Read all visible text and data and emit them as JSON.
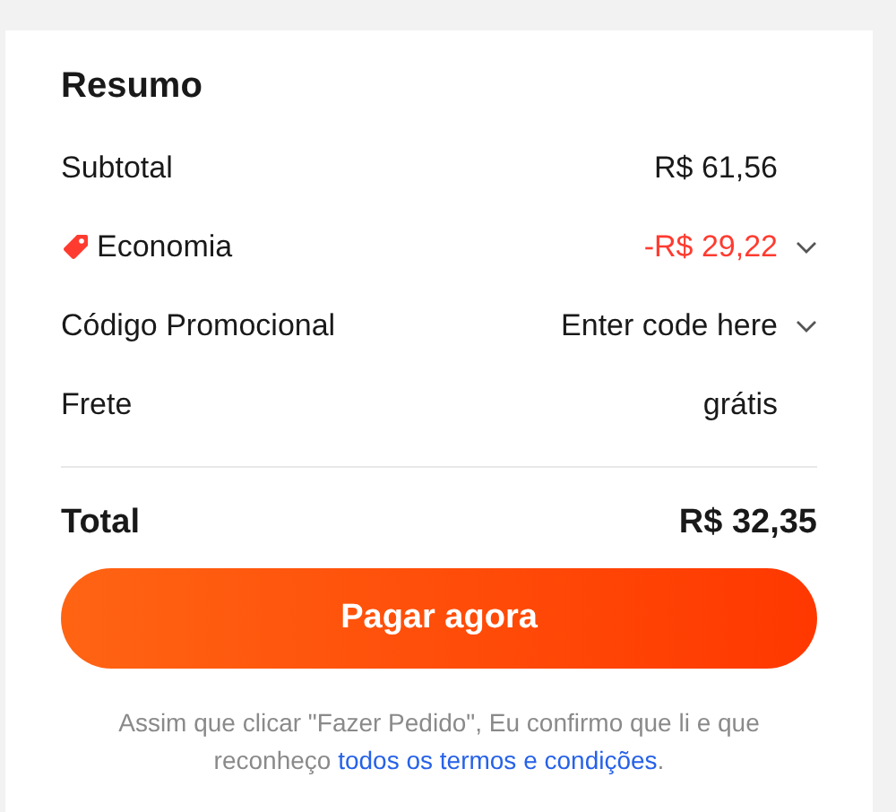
{
  "title": "Resumo",
  "rows": [
    {
      "kind": "amount",
      "label": "Subtotal",
      "value": "R$ 61,56"
    },
    {
      "kind": "discount",
      "label": "Economia",
      "value": "-R$ 29,22"
    },
    {
      "kind": "dropdown",
      "label": "Código Promocional",
      "value": "Enter code here"
    },
    {
      "kind": "amount",
      "label": "Frete",
      "value": "grátis"
    }
  ],
  "total": {
    "label": "Total",
    "value": "R$ 32,35"
  },
  "button": "Pagar agora",
  "note": {
    "text_before": "Assim que clicar \"Fazer Pedido\", Eu confirmo que li e que reconheço ",
    "link": "todos os termos e condições",
    "text_after": "."
  }
}
